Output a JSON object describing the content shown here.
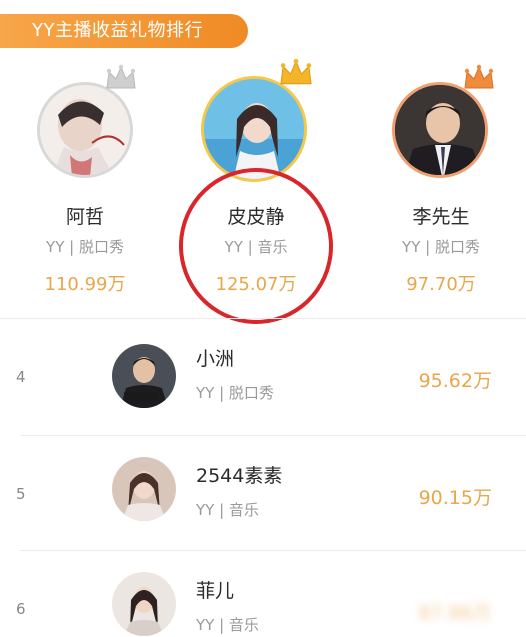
{
  "header": {
    "title": "YY主播收益礼物排行"
  },
  "podium": [
    {
      "rank": 2,
      "name": "阿哲",
      "category": "YY | 脱口秀",
      "score": "110.99万",
      "crown_color": "#c9c9c9",
      "avatar_icon": "avatar-art-icon"
    },
    {
      "rank": 1,
      "name": "皮皮静",
      "category": "YY | 音乐",
      "score": "125.07万",
      "crown_color": "#f5b52a",
      "avatar_icon": "avatar-female-blue-icon"
    },
    {
      "rank": 3,
      "name": "李先生",
      "category": "YY | 脱口秀",
      "score": "97.70万",
      "crown_color": "#f08a3c",
      "avatar_icon": "avatar-suit-male-icon"
    }
  ],
  "list": [
    {
      "rank": "4",
      "name": "小洲",
      "category": "YY | 脱口秀",
      "score": "95.62万"
    },
    {
      "rank": "5",
      "name": "2544素素",
      "category": "YY | 音乐",
      "score": "90.15万"
    },
    {
      "rank": "6",
      "name": "菲儿",
      "category": "YY | 音乐",
      "score": "87.86万"
    }
  ],
  "colors": {
    "accent": "#f08a24",
    "score": "#eaa64a",
    "highlight": "#d9262a"
  }
}
